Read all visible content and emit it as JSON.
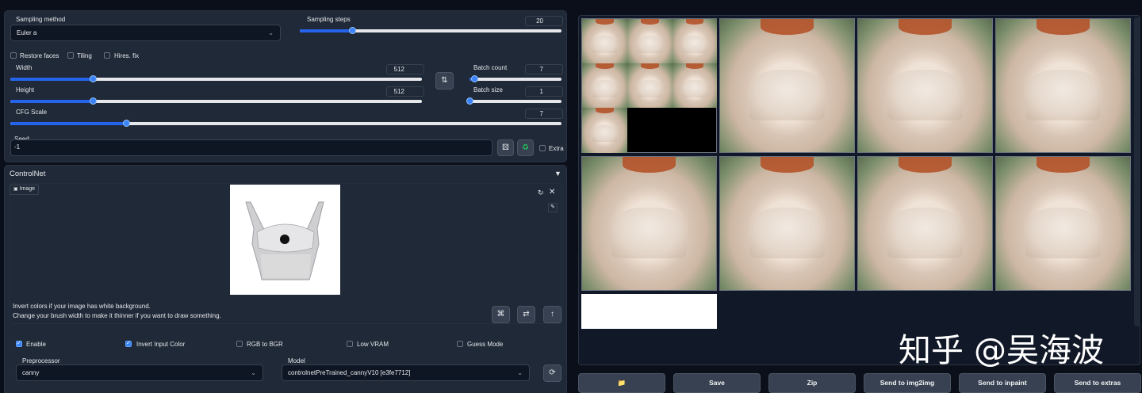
{
  "params": {
    "sampling_method_label": "Sampling method",
    "sampling_method_value": "Euler a",
    "sampling_steps_label": "Sampling steps",
    "sampling_steps_value": "20",
    "restore_faces": "Restore faces",
    "tiling": "Tiling",
    "hires_fix": "Hires. fix",
    "width_label": "Width",
    "width_value": "512",
    "height_label": "Height",
    "height_value": "512",
    "batch_count_label": "Batch count",
    "batch_count_value": "7",
    "batch_size_label": "Batch size",
    "batch_size_value": "1",
    "cfg_label": "CFG Scale",
    "cfg_value": "7",
    "seed_label": "Seed",
    "seed_value": "-1",
    "extra_label": "Extra",
    "sliders": {
      "sampling_steps": 0.2,
      "width": 0.2,
      "height": 0.2,
      "batch_count": 0.05,
      "batch_size": 0.0,
      "cfg_scale": 0.21
    }
  },
  "controlnet": {
    "title": "ControlNet",
    "collapse_icon": "triangle-down-icon",
    "image_tab": "Image",
    "hint_line1": "Invert colors if your image has white background.",
    "hint_line2": "Change your brush width to make it thinner if you want to draw something.",
    "enable": "Enable",
    "invert_input_color": "Invert Input Color",
    "rgb_to_bgr": "RGB to BGR",
    "low_vram": "Low VRAM",
    "guess_mode": "Guess Mode",
    "enable_checked": true,
    "invert_checked": true,
    "preprocessor_label": "Preprocessor",
    "preprocessor_value": "canny",
    "model_label": "Model",
    "model_value": "controlnetPreTrained_cannyV10 [e3fe7712]"
  },
  "gallery": {
    "count": 8
  },
  "actions": {
    "folder": "folder-icon",
    "save": "Save",
    "zip": "Zip",
    "send_img2img": "Send to img2img",
    "send_inpaint": "Send to inpaint",
    "send_extras": "Send to extras"
  },
  "watermark": "知乎 @吴海波",
  "colors": {
    "accent": "#2563eb",
    "background": "#0b0f19",
    "panel": "#1f2937"
  }
}
